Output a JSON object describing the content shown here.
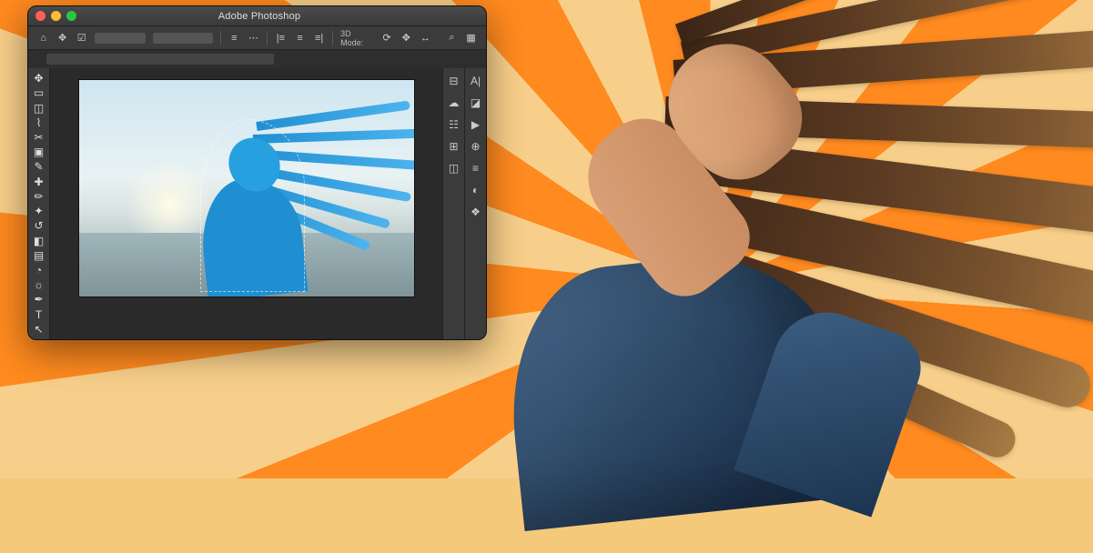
{
  "app": {
    "title": "Adobe Photoshop"
  },
  "optionbar": {
    "home_icon": "home-icon",
    "move_icon": "move-tool-icon",
    "mode_label": "3D Mode:"
  },
  "left_tools": [
    {
      "name": "move-tool-icon",
      "glyph": "✥"
    },
    {
      "name": "artboard-tool-icon",
      "glyph": "▭"
    },
    {
      "name": "marquee-tool-icon",
      "glyph": "◫"
    },
    {
      "name": "lasso-tool-icon",
      "glyph": "⌇"
    },
    {
      "name": "crop-tool-icon",
      "glyph": "✂"
    },
    {
      "name": "frame-tool-icon",
      "glyph": "▣"
    },
    {
      "name": "eyedropper-tool-icon",
      "glyph": "✎"
    },
    {
      "name": "healing-tool-icon",
      "glyph": "✚"
    },
    {
      "name": "brush-tool-icon",
      "glyph": "✏"
    },
    {
      "name": "clone-tool-icon",
      "glyph": "✦"
    },
    {
      "name": "history-brush-icon",
      "glyph": "↺"
    },
    {
      "name": "eraser-tool-icon",
      "glyph": "◧"
    },
    {
      "name": "gradient-tool-icon",
      "glyph": "▤"
    },
    {
      "name": "blur-tool-icon",
      "glyph": "◔"
    },
    {
      "name": "dodge-tool-icon",
      "glyph": "☼"
    },
    {
      "name": "pen-tool-icon",
      "glyph": "✒"
    },
    {
      "name": "type-tool-icon",
      "glyph": "T"
    },
    {
      "name": "path-tool-icon",
      "glyph": "↖"
    }
  ],
  "right_panel_a": [
    {
      "name": "character-panel-icon",
      "glyph": "A|"
    },
    {
      "name": "swatches-panel-icon",
      "glyph": "◪"
    },
    {
      "name": "play-icon",
      "glyph": "▶"
    },
    {
      "name": "color-panel-icon",
      "glyph": "⊕"
    },
    {
      "name": "history-panel-icon",
      "glyph": "≡"
    },
    {
      "name": "adjustments-panel-icon",
      "glyph": "◐"
    },
    {
      "name": "layers-panel-icon",
      "glyph": "❖"
    }
  ],
  "right_panel_b": [
    {
      "name": "properties-panel-icon",
      "glyph": "⊟"
    },
    {
      "name": "libraries-panel-icon",
      "glyph": "☁"
    },
    {
      "name": "props2-icon",
      "glyph": "☷"
    },
    {
      "name": "info-panel-icon",
      "glyph": "⊞"
    },
    {
      "name": "channels-panel-icon",
      "glyph": "◫"
    }
  ]
}
